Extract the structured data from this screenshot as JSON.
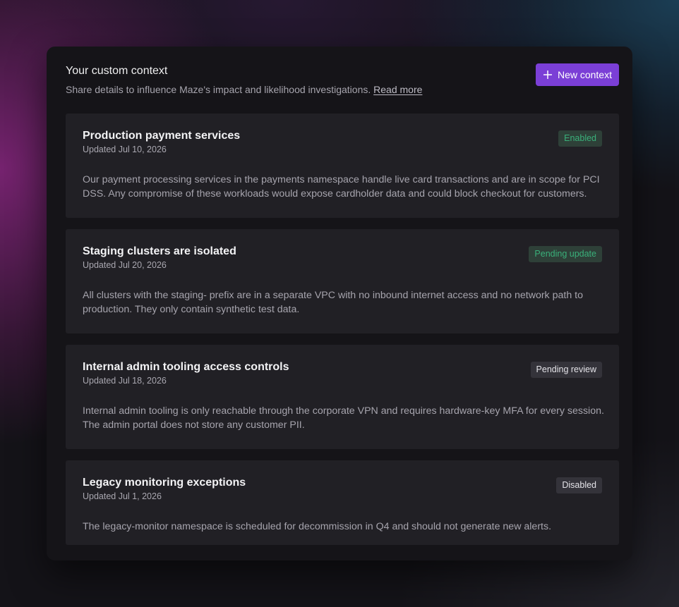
{
  "header": {
    "title": "Your custom context",
    "subtitle": "Share details to influence Maze's impact and likelihood investigations.",
    "read_more": "Read more",
    "new_button_label": "New context",
    "new_button_icon": "plus-icon"
  },
  "colors": {
    "accent": "#7b3fd6",
    "status_green_text": "#3ab07a",
    "status_green_bg": "#2e4038",
    "status_neutral_bg": "#34333a"
  },
  "contexts": [
    {
      "title": "Production payment services",
      "updated": "Updated Jul 10, 2026",
      "status": "Enabled",
      "status_tone": "green",
      "body": "Our payment processing services in the payments namespace handle live card transactions and are in scope for PCI DSS. Any compromise of these workloads would expose cardholder data and could block checkout for customers."
    },
    {
      "title": "Staging clusters are isolated",
      "updated": "Updated Jul 20, 2026",
      "status": "Pending update",
      "status_tone": "green",
      "body": "All clusters with the staging- prefix are in a separate VPC with no inbound internet access and no network path to production. They only contain synthetic test data."
    },
    {
      "title": "Internal admin tooling access controls",
      "updated": "Updated Jul 18, 2026",
      "status": "Pending review",
      "status_tone": "neutral",
      "body": "Internal admin tooling is only reachable through the corporate VPN and requires hardware-key MFA for every session. The admin portal does not store any customer PII."
    },
    {
      "title": "Legacy monitoring exceptions",
      "updated": "Updated Jul 1, 2026",
      "status": "Disabled",
      "status_tone": "neutral",
      "body": "The legacy-monitor namespace is scheduled for decommission in Q4 and should not generate new alerts."
    }
  ]
}
